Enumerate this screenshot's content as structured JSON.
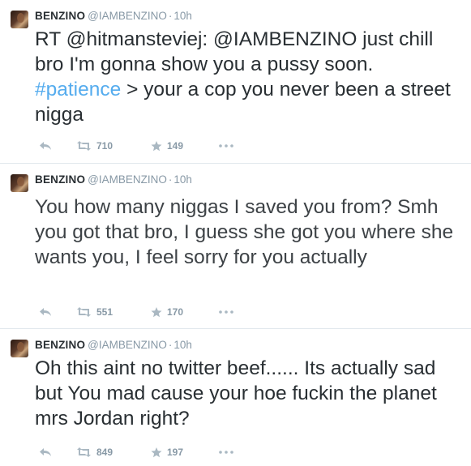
{
  "tweets": [
    {
      "name": "BENZINO",
      "handle": "@IAMBENZINO",
      "separator": "·",
      "time": "10h",
      "segments": [
        {
          "text": "RT @hitmansteviej: @IAMBENZINO just chill bro I'm gonna show you a pussy soon. ",
          "link": false
        },
        {
          "text": "#patience",
          "link": true
        },
        {
          "text": " > your a cop you never been a street nigga",
          "link": false
        }
      ],
      "retweets": "710",
      "favorites": "149"
    },
    {
      "name": "BENZINO",
      "handle": "@IAMBENZINO",
      "separator": "·",
      "time": "10h",
      "segments": [
        {
          "text": "You how many niggas I saved you from? Smh you got that bro, I guess she got you where she wants you, I feel sorry for you actually",
          "link": false
        }
      ],
      "retweets": "551",
      "favorites": "170"
    },
    {
      "name": "BENZINO",
      "handle": "@IAMBENZINO",
      "separator": "·",
      "time": "10h",
      "segments": [
        {
          "text": "Oh this aint no twitter beef...... Its actually sad but You mad cause your hoe fuckin the planet mrs Jordan right?",
          "link": false
        }
      ],
      "retweets": "849",
      "favorites": "197"
    }
  ],
  "icons": {
    "reply": "reply-icon",
    "retweet": "retweet-icon",
    "favorite": "star-icon",
    "more": "more-dots-icon"
  },
  "colors": {
    "link": "#55acee",
    "muted": "#8899a6",
    "icon": "#aab8c2",
    "text": "#292f33"
  }
}
